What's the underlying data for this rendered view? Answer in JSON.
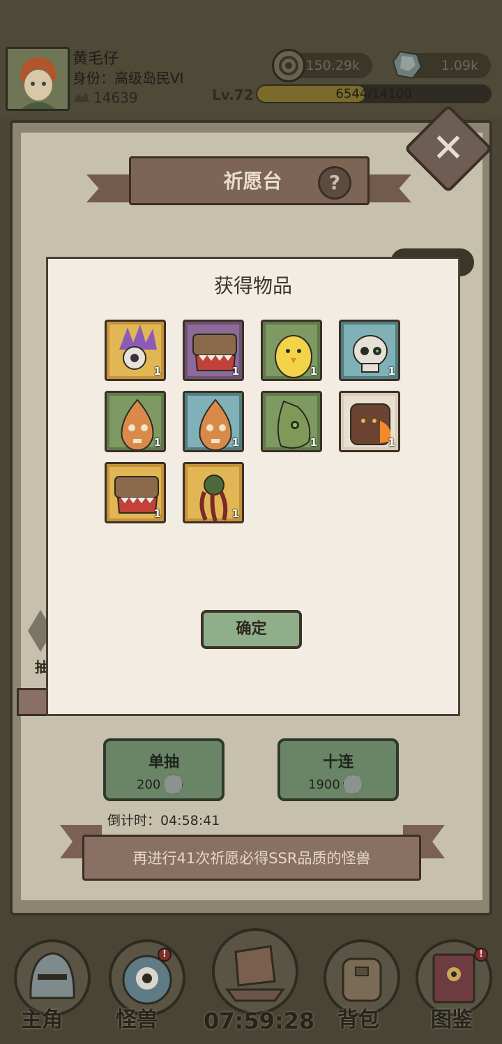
{
  "player": {
    "name": "黄毛仔",
    "rank": "身份：高级岛民VI",
    "power": "14639",
    "level": "Lv.72",
    "xp_text": "6544/14100",
    "xp_fraction": 0.464
  },
  "currency": {
    "coins": "150.29k",
    "gems": "1.09k"
  },
  "panel": {
    "title": "祈愿台",
    "help_icon": "?",
    "close_icon": "close-icon"
  },
  "popup": {
    "title": "获得物品",
    "items": [
      {
        "icon": "crystal-eye-monster-icon",
        "count": "1",
        "frame": "#c4923a",
        "bg": "#e2b655"
      },
      {
        "icon": "mimic-chest-icon",
        "count": "1",
        "frame": "#6c5272",
        "bg": "#8d6a98"
      },
      {
        "icon": "yellow-chick-icon",
        "count": "1",
        "frame": "#5f7a4a",
        "bg": "#7e9a62"
      },
      {
        "icon": "skull-monster-icon",
        "count": "1",
        "frame": "#4f7d80",
        "bg": "#7fb1b6"
      },
      {
        "icon": "sprout-monster-icon",
        "count": "1",
        "frame": "#5f7a4a",
        "bg": "#7e9a62"
      },
      {
        "icon": "sprout-monster-icon",
        "count": "1",
        "frame": "#4f7d80",
        "bg": "#7fb1b6"
      },
      {
        "icon": "green-blob-monster-icon",
        "count": "1",
        "frame": "#5f7a4a",
        "bg": "#7e9a62"
      },
      {
        "icon": "lava-golem-icon",
        "count": "1",
        "frame": "#d8cbb8",
        "bg": "#e9dfd0"
      },
      {
        "icon": "mimic-chest-icon",
        "count": "1",
        "frame": "#c4923a",
        "bg": "#e2b655"
      },
      {
        "icon": "tentacle-plant-icon",
        "count": "1",
        "frame": "#c4923a",
        "bg": "#e2b655"
      }
    ],
    "confirm_label": "确定"
  },
  "background": {
    "side_label": "抽"
  },
  "pulls": {
    "single": {
      "label": "单抽",
      "cost": "200"
    },
    "ten": {
      "label": "十连",
      "cost": "1900"
    },
    "countdown": "倒计时：04:58:41",
    "pity_text": "再进行41次祈愿必得SSR品质的怪兽"
  },
  "nav": {
    "items": [
      {
        "label": "主角",
        "icon": "helmet-icon",
        "badge": ""
      },
      {
        "label": "怪兽",
        "icon": "eye-monster-icon",
        "badge": "!"
      },
      {
        "label": "",
        "icon": "ship-icon",
        "badge": ""
      },
      {
        "label": "背包",
        "icon": "backpack-icon",
        "badge": ""
      },
      {
        "label": "图鉴",
        "icon": "book-icon",
        "badge": "!"
      }
    ],
    "timer": "07:59:28"
  }
}
